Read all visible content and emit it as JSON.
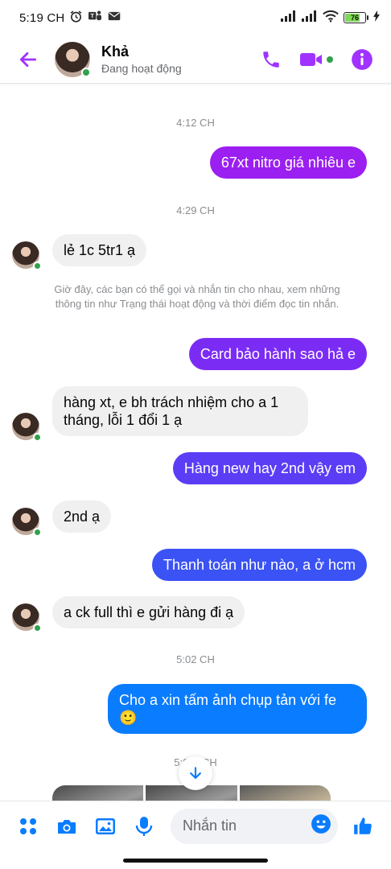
{
  "status_bar": {
    "time": "5:19 CH",
    "battery": "76"
  },
  "header": {
    "name": "Khả",
    "status": "Đang hoạt động"
  },
  "colors": {
    "accent": "#a033ff",
    "online": "#31a24c",
    "incoming_bubble": "#f0f0f0"
  },
  "chat": {
    "timestamps": [
      "4:12 CH",
      "4:29 CH",
      "5:02 CH",
      "5:0… CH"
    ],
    "notice": "Giờ đây, các bạn có thể gọi và nhắn tin cho nhau, xem những thông tin như Trạng thái hoạt động và thời điểm đọc tin nhắn.",
    "messages": [
      {
        "from": "me",
        "text": "67xt nitro giá nhiêu e",
        "color": "#9b1ff0"
      },
      {
        "from": "them",
        "text": "lẻ 1c 5tr1 ạ"
      },
      {
        "from": "me",
        "text": "Card bảo hành sao hả e",
        "color": "#7b2cf4"
      },
      {
        "from": "them",
        "text": "hàng xt, e bh trách nhiệm cho a 1 tháng, lỗi 1 đổi 1 ạ"
      },
      {
        "from": "me",
        "text": "Hàng new hay 2nd vậy em",
        "color": "#5b3df6"
      },
      {
        "from": "them",
        "text": "2nd ạ"
      },
      {
        "from": "me",
        "text": "Thanh toán như nào, a ở hcm",
        "color": "#3b52f4"
      },
      {
        "from": "them",
        "text": "a ck full thì e gửi hàng đi ạ"
      },
      {
        "from": "me",
        "text": "Cho a xin tấm ảnh chụp tản với fe 🙂",
        "color": "#0a7cff"
      }
    ]
  },
  "composer": {
    "placeholder": "Nhắn tin"
  }
}
